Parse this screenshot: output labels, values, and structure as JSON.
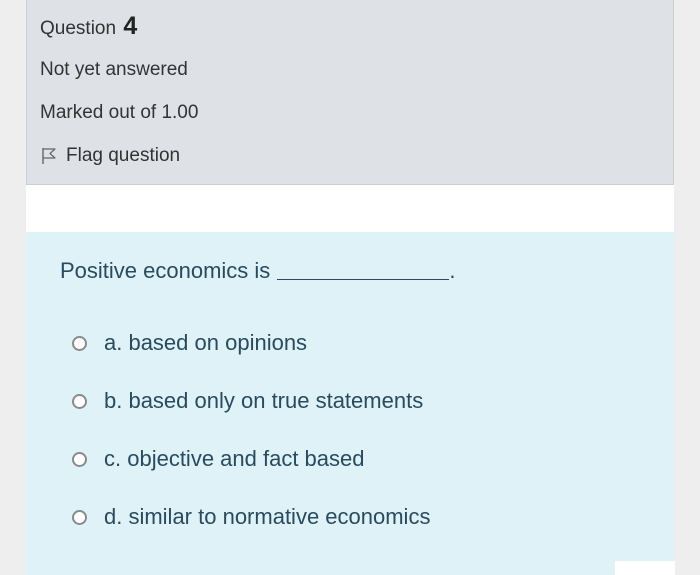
{
  "question_info": {
    "label": "Question",
    "number": "4",
    "state": "Not yet answered",
    "grade": "Marked out of 1.00",
    "flag_label": "Flag question"
  },
  "question": {
    "text": "Positive economics is",
    "suffix": ".",
    "options": [
      {
        "label": "a. based on opinions"
      },
      {
        "label": "b. based only on true statements"
      },
      {
        "label": "c. objective and fact based"
      },
      {
        "label": "d. similar to normative economics"
      }
    ]
  },
  "colors": {
    "info_background": "#dee2e6",
    "content_background": "#def2f8",
    "question_text": "#2a4a5e"
  },
  "icons": {
    "flag": "flag-outline-icon",
    "radio": "radio-unchecked"
  }
}
